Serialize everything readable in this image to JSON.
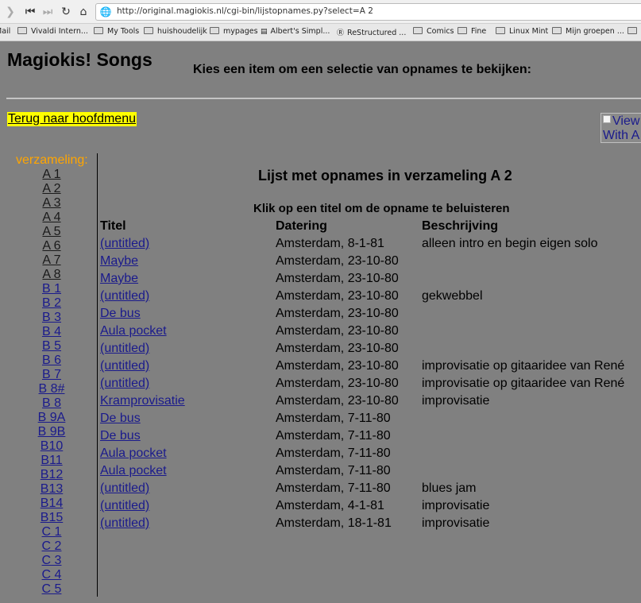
{
  "browser": {
    "url": "http://original.magiokis.nl/cgi-bin/lijstopnames.py?select=A 2",
    "bookmarks": [
      "Mail",
      "Vivaldi Intern...",
      "My Tools",
      "huishoudelijk",
      "mypages",
      "Albert's Simpl...",
      "ReStructured ...",
      "Comics",
      "Fine",
      "Linux Mint",
      "Mijn groepen ..."
    ]
  },
  "page": {
    "site_title": "Magiokis! Songs",
    "subtitle": "Kies een item om een selectie van opnames te bekijken:",
    "back_link": "Terug naar hoofdmenu",
    "badge_text_1": "View",
    "badge_text_2": "With A"
  },
  "sidebar": {
    "label": "verzameling:",
    "items": [
      "A 1",
      "A 2",
      "A 3",
      "A 4",
      "A 5",
      "A 6",
      "A 7",
      "A 8",
      "B 1",
      "B 2",
      "B 3",
      "B 4",
      "B 5",
      "B 6",
      "B 7",
      "B 8#",
      "B 8",
      "B 9A",
      "B 9B",
      "B10",
      "B11",
      "B12",
      "B13",
      "B14",
      "B15",
      "C 1",
      "C 2",
      "C 3",
      "C 4",
      "C 5"
    ]
  },
  "main": {
    "title": "Lijst met opnames in verzameling A 2",
    "instruction": "Klik op een titel om de opname te beluisteren",
    "headers": [
      "Titel",
      "Datering",
      "Beschrijving"
    ],
    "rows": [
      [
        "(untitled)",
        "Amsterdam, 8-1-81",
        "alleen intro en begin eigen solo"
      ],
      [
        "Maybe",
        "Amsterdam, 23-10-80",
        ""
      ],
      [
        "Maybe",
        "Amsterdam, 23-10-80",
        ""
      ],
      [
        "(untitled)",
        "Amsterdam, 23-10-80",
        "gekwebbel"
      ],
      [
        "De bus",
        "Amsterdam, 23-10-80",
        ""
      ],
      [
        "Aula pocket",
        "Amsterdam, 23-10-80",
        ""
      ],
      [
        "(untitled)",
        "Amsterdam, 23-10-80",
        ""
      ],
      [
        "(untitled)",
        "Amsterdam, 23-10-80",
        "improvisatie op gitaaridee van René"
      ],
      [
        "(untitled)",
        "Amsterdam, 23-10-80",
        "improvisatie op gitaaridee van René"
      ],
      [
        "Kramprovisatie",
        "Amsterdam, 23-10-80",
        "improvisatie"
      ],
      [
        "De bus",
        "Amsterdam, 7-11-80",
        ""
      ],
      [
        "De bus",
        "Amsterdam, 7-11-80",
        ""
      ],
      [
        "Aula pocket",
        "Amsterdam, 7-11-80",
        ""
      ],
      [
        "Aula pocket",
        "Amsterdam, 7-11-80",
        ""
      ],
      [
        "(untitled)",
        "Amsterdam, 7-11-80",
        "blues jam"
      ],
      [
        "(untitled)",
        "Amsterdam, 4-1-81",
        "improvisatie"
      ],
      [
        "(untitled)",
        "Amsterdam, 18-1-81",
        "improvisatie"
      ]
    ]
  }
}
